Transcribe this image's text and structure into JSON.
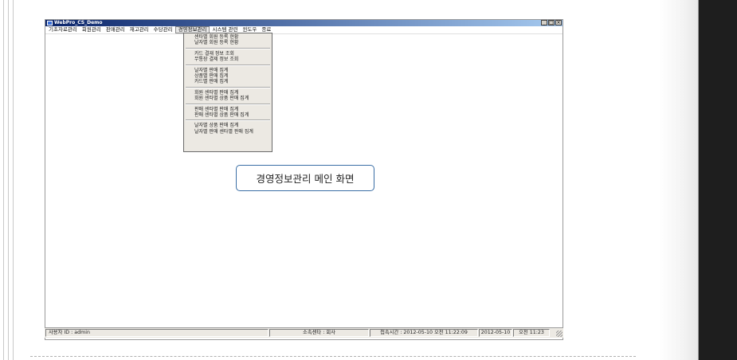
{
  "window": {
    "title": "WebPro_CS_Demo",
    "controls": {
      "minimize": "_",
      "maximize": "□",
      "close": "×"
    }
  },
  "menubar": {
    "items": [
      "기초자료관리",
      "회원관리",
      "판매관리",
      "재고관리",
      "수당관리",
      "경영정보관리",
      "시스템 관련",
      "윈도우",
      "종료"
    ],
    "active_index": 5
  },
  "dropdown": {
    "groups": [
      [
        "센타별 회원 등록 현황",
        "날자별 회원 등록 현황"
      ],
      [
        "카드 결재 정보 조회",
        "무통장 결제 정보 조회"
      ],
      [
        "날자별 판매 집계",
        "상품별 판매 집계",
        "카드별 판매 집계"
      ],
      [
        "회원 센타별 판매 집계",
        "회원 센타별 상품 판매 집계"
      ],
      [
        "판매 센타별 판매 집계",
        "판매 센타별 상품 판매 집계"
      ],
      [
        "날자별 상품 판매 집계",
        "날자별 판매 센타별 판매 집계"
      ]
    ]
  },
  "callout": {
    "text": "경영정보관리 메인 화면"
  },
  "statusbar": {
    "user": "사용자 ID : admin",
    "center": "소속센타 : 회사",
    "login_time": "접속시간 : 2012-05-10 오전 11:22:09",
    "date": "2012-05-10",
    "time": "오전 11:23"
  },
  "colors": {
    "titlebar_start": "#0a246a",
    "titlebar_end": "#a6caf0",
    "callout_border": "#3a6ea5"
  }
}
